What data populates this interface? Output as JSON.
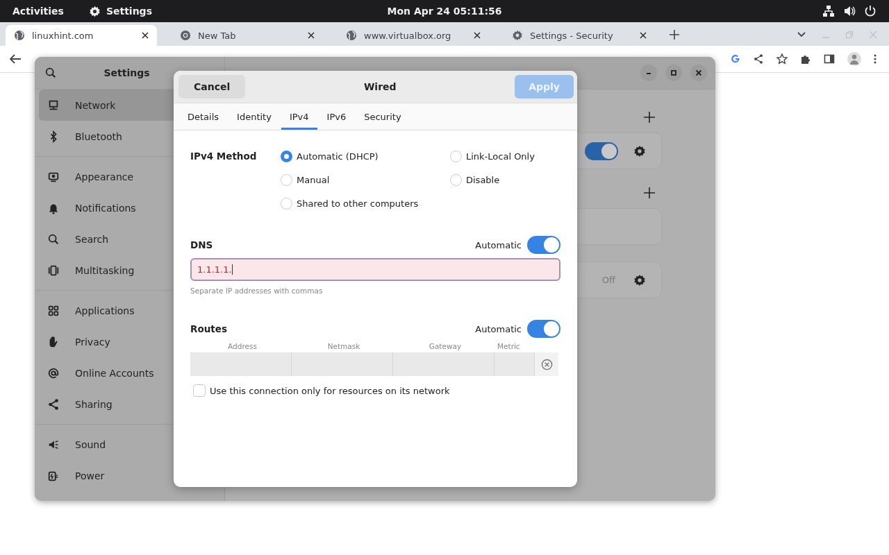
{
  "top_bar": {
    "activities": "Activities",
    "app_name": "Settings",
    "clock": "Mon Apr 24  05:11:56"
  },
  "browser": {
    "tabs": [
      {
        "title": "linuxhint.com",
        "kind": "web",
        "selected": true
      },
      {
        "title": "New Tab",
        "kind": "newtab",
        "selected": false
      },
      {
        "title": "www.virtualbox.org",
        "kind": "web",
        "selected": false
      },
      {
        "title": "Settings - Security",
        "kind": "settings",
        "selected": false
      }
    ]
  },
  "settings": {
    "title": "Settings",
    "sidebar": {
      "groups": [
        [
          {
            "label": "Network",
            "selected": true
          },
          {
            "label": "Bluetooth",
            "selected": false
          }
        ],
        [
          {
            "label": "Appearance",
            "selected": false
          },
          {
            "label": "Notifications",
            "selected": false
          },
          {
            "label": "Search",
            "selected": false
          },
          {
            "label": "Multitasking",
            "selected": false
          }
        ],
        [
          {
            "label": "Applications",
            "selected": false
          },
          {
            "label": "Privacy",
            "selected": false
          },
          {
            "label": "Online Accounts",
            "selected": false
          },
          {
            "label": "Sharing",
            "selected": false
          }
        ],
        [
          {
            "label": "Sound",
            "selected": false
          },
          {
            "label": "Power",
            "selected": false
          }
        ]
      ]
    },
    "network": {
      "wired_on": true,
      "proxy_status": "Off"
    }
  },
  "dialog": {
    "cancel": "Cancel",
    "title": "Wired",
    "apply": "Apply",
    "apply_disabled": true,
    "tabs": [
      {
        "label": "Details",
        "selected": false
      },
      {
        "label": "Identity",
        "selected": false
      },
      {
        "label": "IPv4",
        "selected": true
      },
      {
        "label": "IPv6",
        "selected": false
      },
      {
        "label": "Security",
        "selected": false
      }
    ],
    "method_label": "IPv4 Method",
    "methods": [
      {
        "label": "Automatic (DHCP)",
        "selected": true
      },
      {
        "label": "Link-Local Only",
        "selected": false
      },
      {
        "label": "Manual",
        "selected": false
      },
      {
        "label": "Disable",
        "selected": false
      },
      {
        "label": "Shared to other computers",
        "selected": false
      }
    ],
    "dns": {
      "label": "DNS",
      "automatic_label": "Automatic",
      "automatic": true,
      "value": "1.1.1.1.",
      "invalid": true,
      "hint": "Separate IP addresses with commas"
    },
    "routes": {
      "label": "Routes",
      "automatic_label": "Automatic",
      "automatic": true,
      "columns": [
        "Address",
        "Netmask",
        "Gateway",
        "Metric"
      ]
    },
    "only_local": {
      "label": "Use this connection only for resources on its network",
      "checked": false
    }
  }
}
